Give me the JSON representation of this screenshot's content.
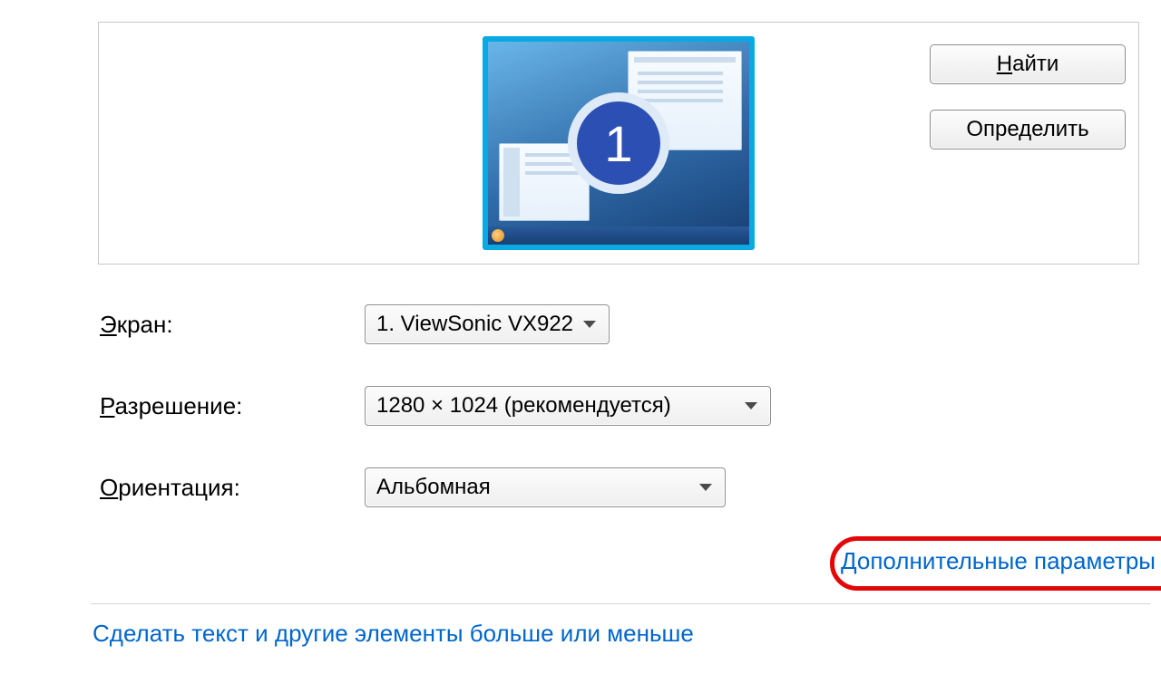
{
  "preview": {
    "monitor_number": "1"
  },
  "buttons": {
    "find_prefix_ul": "Н",
    "find_rest": "айти",
    "identify": "Определить"
  },
  "labels": {
    "screen_ul": "Э",
    "screen_rest": "кран:",
    "resolution_ul": "Р",
    "resolution_rest": "азрешение:",
    "orientation_ul": "О",
    "orientation_rest": "риентация:"
  },
  "dropdowns": {
    "screen": "1. ViewSonic VX922",
    "resolution": "1280 × 1024 (рекомендуется)",
    "orientation": "Альбомная"
  },
  "links": {
    "advanced": "Дополнительные параметры",
    "textsize": "Сделать текст и другие элементы больше или меньше"
  }
}
